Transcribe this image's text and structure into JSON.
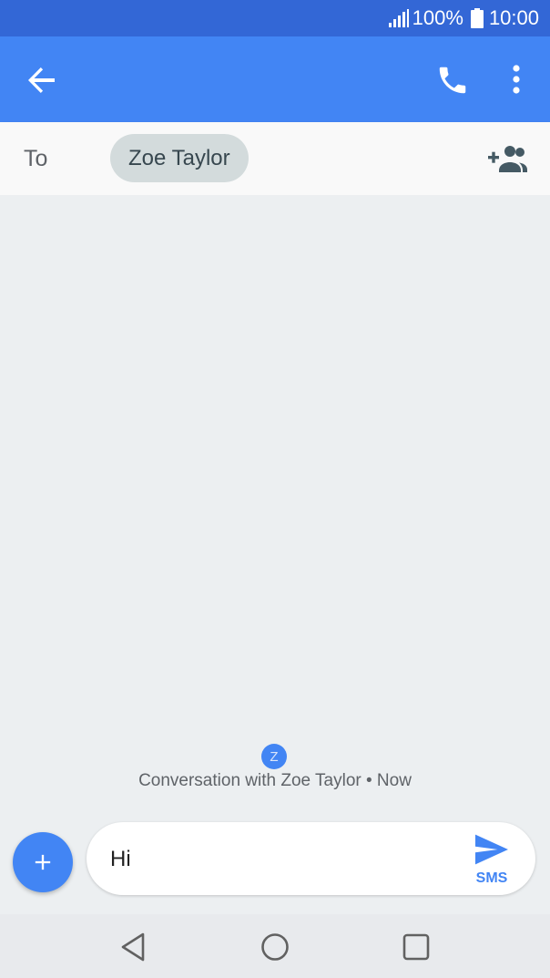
{
  "status_bar": {
    "battery_percent": "100%",
    "time": "10:00",
    "icons": [
      "signal-icon",
      "battery-icon"
    ]
  },
  "app_bar": {
    "icons": [
      "back-arrow-icon",
      "phone-icon",
      "more-vert-icon"
    ],
    "color": "#4285f4"
  },
  "recipient": {
    "to_label": "To",
    "chip_name": "Zoe Taylor",
    "icon": "add-person-icon"
  },
  "conversation": {
    "avatar_letter": "Z",
    "info": "Conversation with Zoe Taylor • Now"
  },
  "compose": {
    "value": "Hi",
    "send_label": "SMS",
    "icons": [
      "add-icon",
      "send-icon"
    ]
  },
  "nav_bar": {
    "icons": [
      "back-triangle-icon",
      "home-circle-icon",
      "recents-square-icon"
    ]
  },
  "colors": {
    "status_bar": "#3367d6",
    "primary": "#4285f4",
    "background": "#eceff1"
  }
}
